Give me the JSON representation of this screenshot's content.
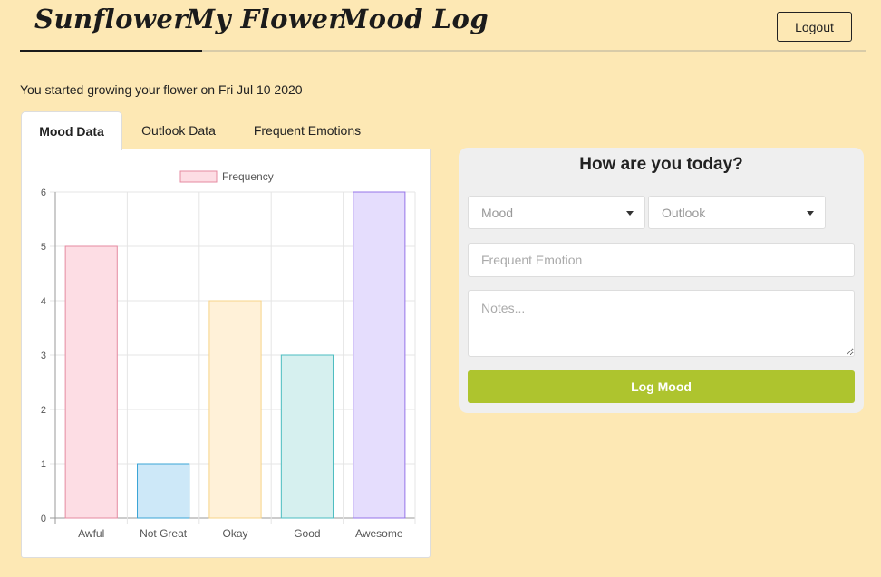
{
  "nav": {
    "brand": "Sunflower",
    "my_flower": "My Flower",
    "mood_log": "Mood Log",
    "logout": "Logout"
  },
  "started_text": "You started growing your flower on Fri Jul 10 2020",
  "tabs": [
    "Mood Data",
    "Outlook Data",
    "Frequent Emotions"
  ],
  "active_tab": "Mood Data",
  "chart_data": {
    "type": "bar",
    "categories": [
      "Awful",
      "Not Great",
      "Okay",
      "Good",
      "Awesome"
    ],
    "series": [
      {
        "name": "Frequency",
        "values": [
          5,
          1,
          4,
          3,
          6
        ]
      }
    ],
    "ylim": [
      0,
      6
    ],
    "yticks": [
      0,
      1,
      2,
      3,
      4,
      5,
      6
    ],
    "grid": true,
    "legend": "top",
    "colors": {
      "fills": [
        "#fddde4",
        "#cde8f8",
        "#fff1d8",
        "#d6f0ef",
        "#e5ddfd"
      ],
      "borders": [
        "#e58aa0",
        "#3aa4d6",
        "#f7d488",
        "#4bbcc0",
        "#9574e8"
      ]
    }
  },
  "form": {
    "title": "How are you today?",
    "mood_placeholder": "Mood",
    "outlook_placeholder": "Outlook",
    "emotion_placeholder": "Frequent Emotion",
    "notes_placeholder": "Notes...",
    "submit": "Log Mood"
  },
  "colors": {
    "background": "#fde8b4",
    "accent": "#aec42e"
  }
}
